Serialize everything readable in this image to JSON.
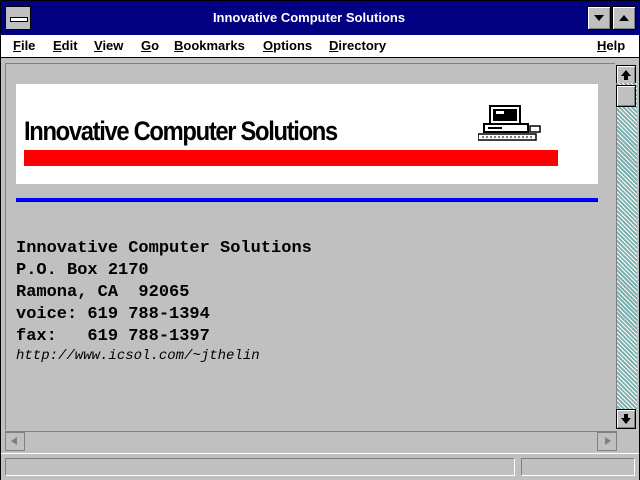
{
  "window": {
    "title": "Innovative Computer Solutions"
  },
  "menu": {
    "file": "File",
    "edit": "Edit",
    "view": "View",
    "go": "Go",
    "bookmarks": "Bookmarks",
    "options": "Options",
    "directory": "Directory",
    "help": "Help"
  },
  "banner": {
    "title": "Innovative Computer Solutions",
    "accent_color": "#ff0000",
    "icon": "computer-icon"
  },
  "address": {
    "line1": "Innovative Computer Solutions",
    "line2": "P.O. Box 2170",
    "line3": "Ramona, CA  92065",
    "line4": "voice: 619 788-1394",
    "line5": "fax:   619 788-1397",
    "url": "http://www.icsol.com/~jthelin"
  },
  "colors": {
    "titlebar": "#000080",
    "rule": "#0000ff",
    "scroll_track": "#7fb0b0"
  }
}
